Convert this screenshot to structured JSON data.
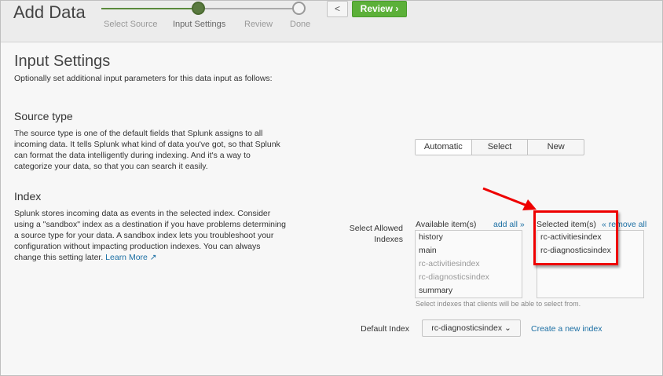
{
  "header": {
    "title": "Add Data",
    "steps": [
      {
        "label": "Select Source",
        "state": "complete"
      },
      {
        "label": "Input Settings",
        "state": "current"
      },
      {
        "label": "Review",
        "state": "pending"
      },
      {
        "label": "Done",
        "state": "pending"
      }
    ],
    "back_label": "<",
    "review_label": "Review ›"
  },
  "page": {
    "title": "Input Settings",
    "subtitle": "Optionally set additional input parameters for this data input as follows:"
  },
  "source_type": {
    "heading": "Source type",
    "description": "The source type is one of the default fields that Splunk assigns to all incoming data. It tells Splunk what kind of data you've got, so that Splunk can format the data intelligently during indexing. And it's a way to categorize your data, so that you can search it easily.",
    "options": [
      "Automatic",
      "Select",
      "New"
    ],
    "selected": "Automatic"
  },
  "index": {
    "heading": "Index",
    "description": "Splunk stores incoming data as events in the selected index. Consider using a \"sandbox\" index as a destination if you have problems determining a source type for your data. A sandbox index lets you troubleshoot your configuration without impacting production indexes. You can always change this setting later.",
    "learn_more": "Learn More ↗",
    "allowed_label": "Select Allowed Indexes",
    "available_header": "Available item(s)",
    "add_all": "add all »",
    "selected_header": "Selected item(s)",
    "remove_all": "« remove all",
    "available_items": [
      {
        "label": "history",
        "disabled": false
      },
      {
        "label": "main",
        "disabled": false
      },
      {
        "label": "rc-activitiesindex",
        "disabled": true
      },
      {
        "label": "rc-diagnosticsindex",
        "disabled": true
      },
      {
        "label": "summary",
        "disabled": false
      }
    ],
    "selected_items": [
      "rc-activitiesindex",
      "rc-diagnosticsindex"
    ],
    "hint": "Select indexes that clients will be able to select from.",
    "default_label": "Default Index",
    "default_value": "rc-diagnosticsindex ⌄",
    "create_link": "Create a new index"
  },
  "colors": {
    "accent_green": "#5cb039",
    "step_line_done": "#5a8a3c",
    "link": "#1a6ea3",
    "highlight": "#ee0000"
  }
}
